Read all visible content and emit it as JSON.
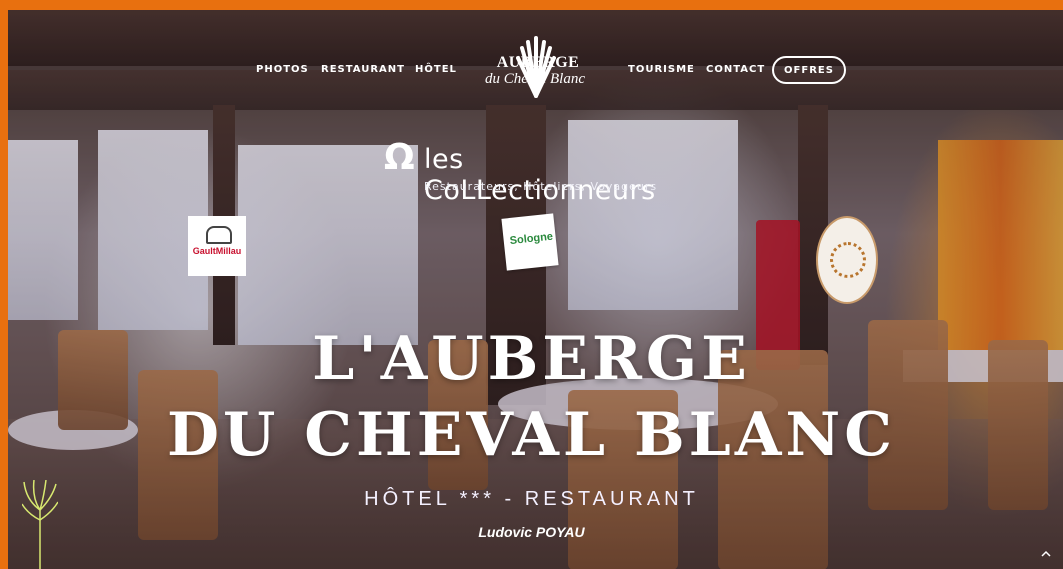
{
  "nav": {
    "left": [
      "PHOTOS",
      "RESTAURANT",
      "HÔTEL"
    ],
    "right": [
      "TOURISME",
      "CONTACT"
    ],
    "offers": "OFFRES"
  },
  "logo": {
    "line1": "AUBERGE",
    "line2": "du Cheval Blanc"
  },
  "partner": {
    "mark": "Ω",
    "name": "les CoLLectionneurs",
    "tagline": "Restaurateurs, Hôteliers, Voyageurs"
  },
  "badges": {
    "gault_millau": "GaultMillau",
    "sologne": "Sologne"
  },
  "hero": {
    "title_line1": "L'AUBERGE",
    "title_line2": "DU CHEVAL BLANC",
    "subtitle": "HÔTEL *** - RESTAURANT",
    "chef": "Ludovic POYAU"
  },
  "colors": {
    "border": "#e8700f",
    "text": "#ffffff"
  }
}
